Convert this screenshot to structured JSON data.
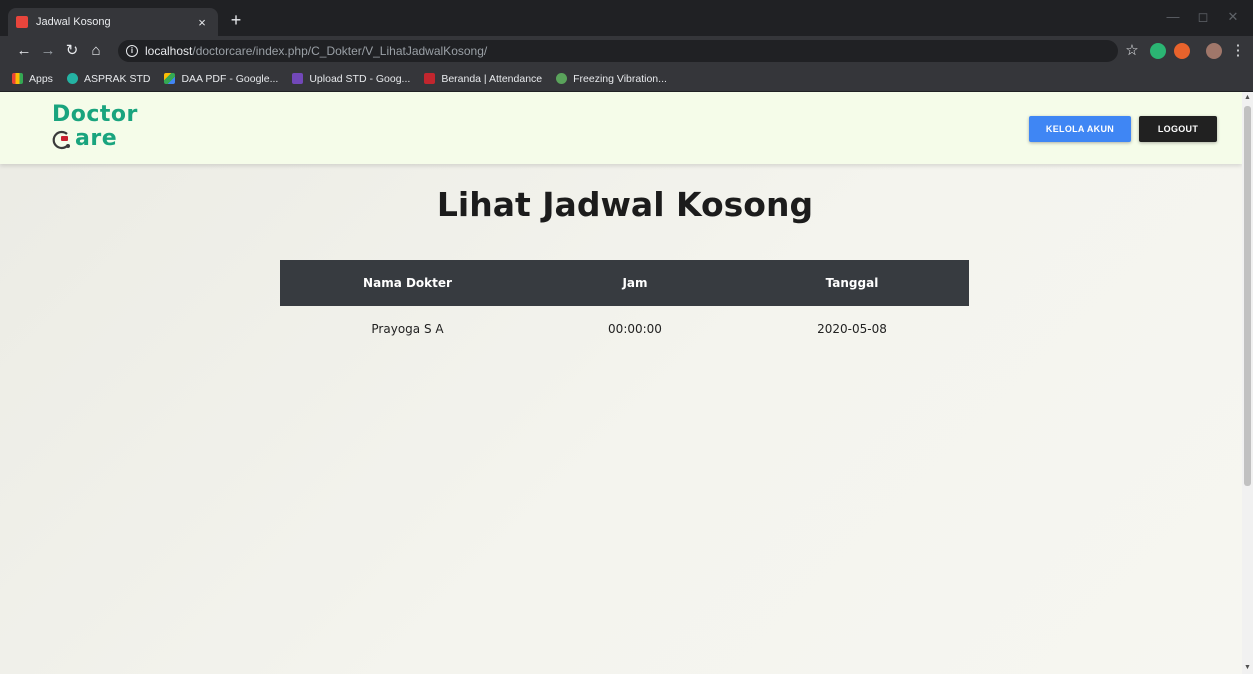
{
  "browser": {
    "tab_title": "Jadwal Kosong",
    "tab_close": "×",
    "new_tab": "+",
    "url_host": "localhost",
    "url_path": "/doctorcare/index.php/C_Dokter/V_LihatJadwalKosong/",
    "bookmarks": [
      "Apps",
      "ASPRAK STD",
      "DAA PDF - Google...",
      "Upload STD - Goog...",
      "Beranda | Attendance",
      "Freezing Vibration..."
    ],
    "icons": {
      "back": "arrow-left-icon",
      "forward": "arrow-right-icon",
      "reload": "reload-icon",
      "home": "home-icon",
      "info": "info-icon",
      "star": "star-icon",
      "menu": "kebab-menu-icon"
    }
  },
  "site": {
    "logo_line1": "Doctor",
    "logo_line2": "are",
    "brand_color": "#19a47e",
    "kelola_label": "KELOLA AKUN",
    "logout_label": "LOGOUT",
    "kelola_color": "#3f86f4",
    "logout_color": "#212121"
  },
  "main": {
    "title": "Lihat Jadwal Kosong",
    "table": {
      "headers": [
        "Nama Dokter",
        "Jam",
        "Tanggal"
      ],
      "rows": [
        [
          "Prayoga S A",
          "00:00:00",
          "2020-05-08"
        ]
      ],
      "header_color": "#373b40"
    }
  }
}
